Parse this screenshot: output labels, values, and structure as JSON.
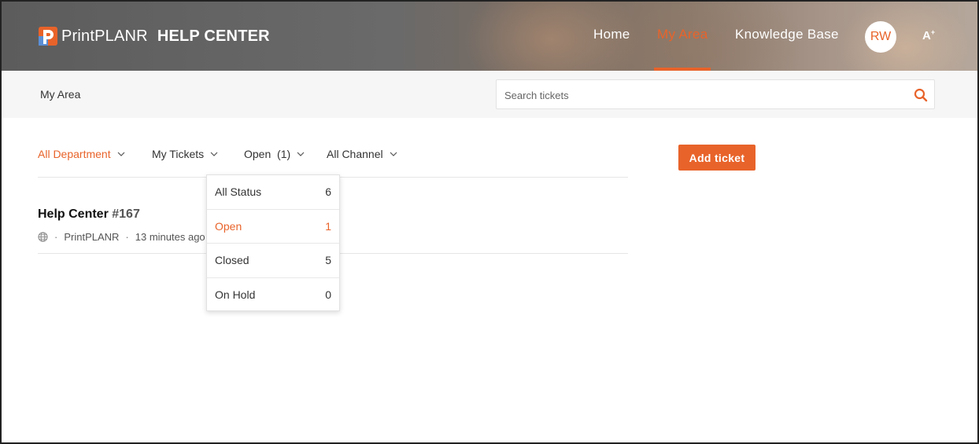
{
  "colors": {
    "accent": "#e8632a",
    "white": "#ffffff",
    "text": "#333333"
  },
  "header": {
    "logo_brand_light": "Print",
    "logo_brand_bold": "PLANR",
    "logo_suffix": "HELP CENTER",
    "nav": [
      {
        "label": "Home",
        "active": false
      },
      {
        "label": "My Area",
        "active": true
      },
      {
        "label": "Knowledge Base",
        "active": false
      }
    ],
    "avatar_initials": "RW",
    "a11y_label": "A"
  },
  "subbar": {
    "breadcrumb": "My Area",
    "search_placeholder": "Search tickets",
    "search_icon": "search-icon"
  },
  "filters": {
    "department": "All Department",
    "tickets": "My Tickets",
    "status": "Open  (1)",
    "channel": "All Channel",
    "add_ticket": "Add ticket"
  },
  "ticket": {
    "title": "Help Center",
    "number": "#167",
    "channel_icon": "globe-icon",
    "account": "PrintPLANR",
    "time": "13 minutes ago"
  },
  "status_dropdown": [
    {
      "label": "All Status",
      "count": "6",
      "active": false
    },
    {
      "label": "Open",
      "count": "1",
      "active": true
    },
    {
      "label": "Closed",
      "count": "5",
      "active": false
    },
    {
      "label": "On Hold",
      "count": "0",
      "active": false
    }
  ]
}
